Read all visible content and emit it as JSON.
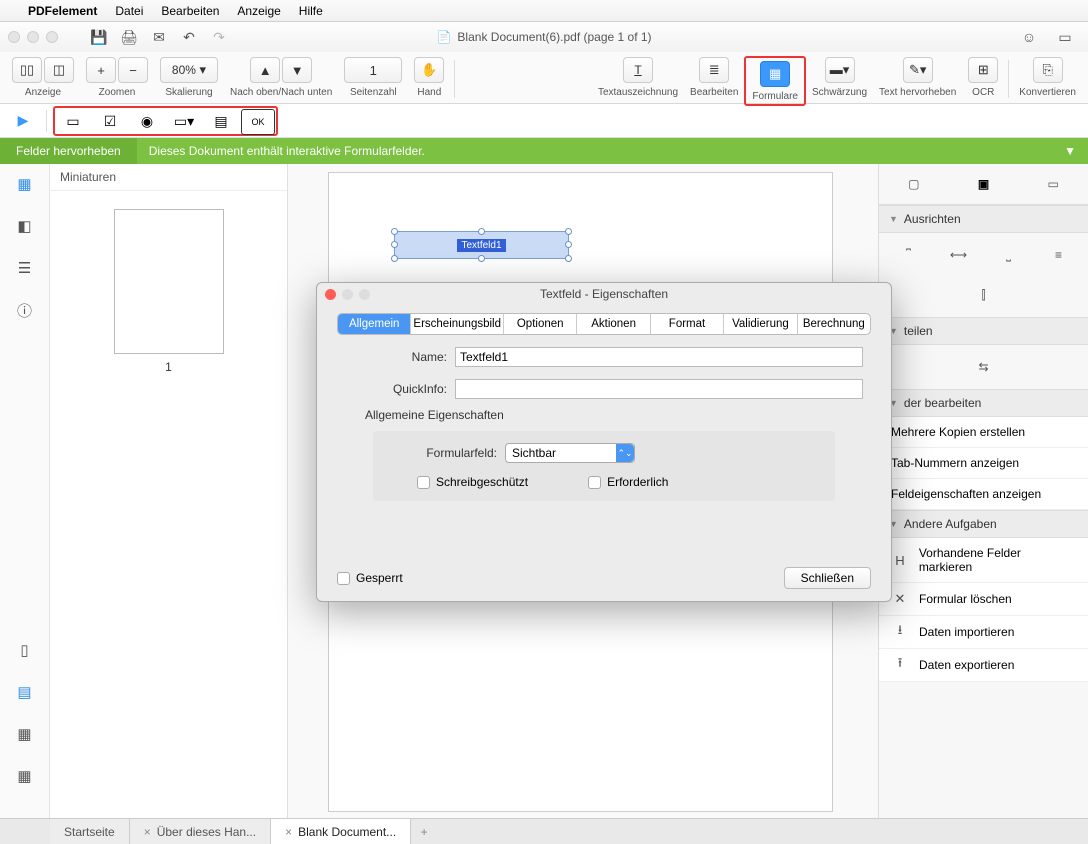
{
  "menubar": {
    "app": "PDFelement",
    "items": [
      "Datei",
      "Bearbeiten",
      "Anzeige",
      "Hilfe"
    ]
  },
  "doc_title": "Blank Document(6).pdf (page 1 of 1)",
  "toolbar2": {
    "anzeige": "Anzeige",
    "zoomen": "Zoomen",
    "skalierung": "Skalierung",
    "zoom_value": "80%",
    "nach": "Nach oben/Nach unten",
    "seitenzahl": "Seitenzahl",
    "page_value": "1",
    "hand": "Hand",
    "textaus": "Textauszeichnung",
    "bearbeiten": "Bearbeiten",
    "formulare": "Formulare",
    "schwarzung": "Schwärzung",
    "text_herv": "Text hervorheben",
    "ocr": "OCR",
    "konvertieren": "Konvertieren"
  },
  "greenbar": {
    "btn": "Felder hervorheben",
    "msg": "Dieses Dokument enthält interaktive Formularfelder."
  },
  "thumbs": {
    "title": "Miniaturen",
    "page": "1"
  },
  "textfield_label": "Textfeld1",
  "right_panel": {
    "sec_ausrichten": "Ausrichten",
    "sec_teilen": "teilen",
    "sec_bearbeiten": "der bearbeiten",
    "felder": {
      "mehrere": "Mehrere Kopien erstellen",
      "tab": "Tab-Nummern anzeigen",
      "eigen": "Feldeigenschaften anzeigen"
    },
    "sec_andere": "Andere Aufgaben",
    "andere": {
      "vorhandene": "Vorhandene Felder markieren",
      "loeschen": "Formular löschen",
      "import": "Daten importieren",
      "export": "Daten exportieren"
    }
  },
  "dialog": {
    "title": "Textfeld - Eigenschaften",
    "tabs": [
      "Allgemein",
      "Erscheinungsbild",
      "Optionen",
      "Aktionen",
      "Format",
      "Validierung",
      "Berechnung"
    ],
    "name_label": "Name:",
    "name_value": "Textfeld1",
    "quickinfo_label": "QuickInfo:",
    "quickinfo_value": "",
    "group_legend": "Allgemeine Eigenschaften",
    "formularfeld_label": "Formularfeld:",
    "formularfeld_value": "Sichtbar",
    "schreib": "Schreibgeschützt",
    "erforderlich": "Erforderlich",
    "gesperrt": "Gesperrt",
    "close": "Schließen"
  },
  "bottom_tabs": {
    "t1": "Startseite",
    "t2": "Über dieses Han...",
    "t3": "Blank Document..."
  }
}
